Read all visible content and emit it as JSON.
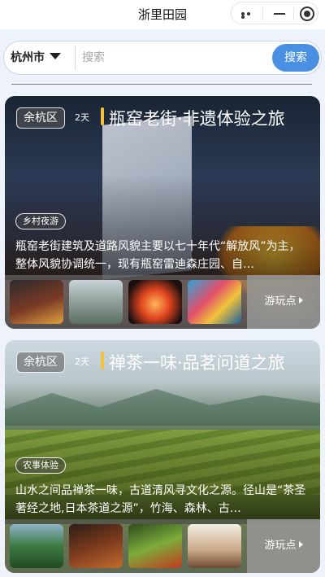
{
  "app": {
    "title": "浙里田园"
  },
  "search": {
    "city": "杭州市",
    "placeholder": "搜索",
    "button_label": "搜索"
  },
  "routes": [
    {
      "district": "余杭区",
      "days": "2天",
      "title": "瓶窑老街·非遗体验之旅",
      "tag": "乡村夜游",
      "description": "瓶窑老街建筑及道路风貌主要以七十年代“解放风”为主，整体风貌协调统一，现有瓶窑雷迪森庄园、自…",
      "more_label": "游玩点",
      "thumbnails": [
        "night-street-photo",
        "village-houses-photo",
        "lantern-gate-photo",
        "mural-wall-photo"
      ]
    },
    {
      "district": "余杭区",
      "days": "2天",
      "title": "禅茶一味·品茗问道之旅",
      "tag": "农事体验",
      "description": "山水之间品禅茶一味，古道清风寻文化之源。径山是“茶圣著经之地,日本茶道之源”，竹海、森林、古…",
      "more_label": "游玩点",
      "thumbnails": [
        "mountain-temple-photo",
        "tea-ceremony-photo",
        "fruit-harvest-photo",
        "tea-room-photo"
      ]
    }
  ],
  "colors": {
    "accent": "#4a90e2",
    "title_bar": "#f3c23a",
    "background": "#eef3fb"
  }
}
